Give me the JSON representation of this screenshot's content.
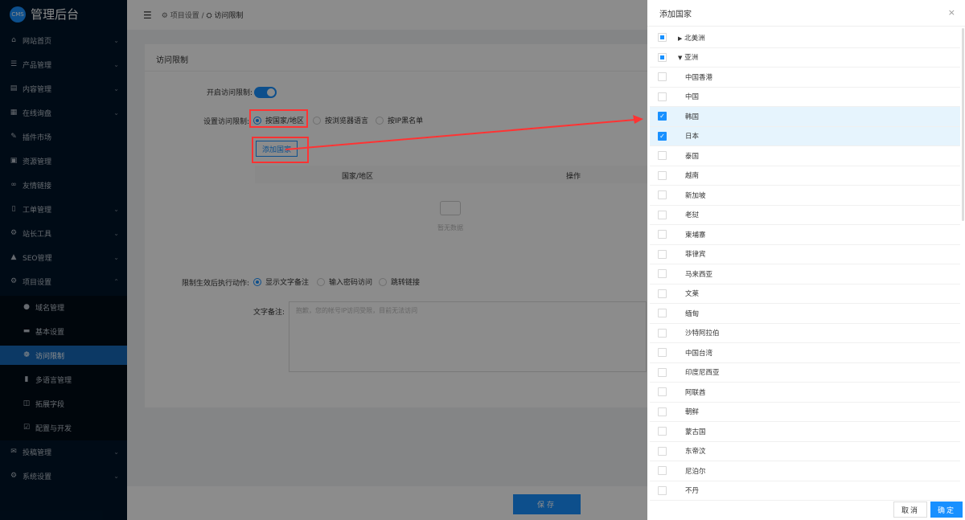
{
  "app": {
    "logo_badge": "CMS",
    "title": "管理后台"
  },
  "sidebar": {
    "items": [
      {
        "label": "网站首页",
        "icon": "home-icon",
        "chev": "⌄"
      },
      {
        "label": "产品管理",
        "icon": "list-icon",
        "chev": "⌄"
      },
      {
        "label": "内容管理",
        "icon": "content-icon",
        "chev": "⌄"
      },
      {
        "label": "在线询盘",
        "icon": "table-icon",
        "chev": "⌄"
      },
      {
        "label": "插件市场",
        "icon": "pin-icon",
        "chev": ""
      },
      {
        "label": "资源管理",
        "icon": "grid-icon",
        "chev": ""
      },
      {
        "label": "友情链接",
        "icon": "link-icon",
        "chev": ""
      },
      {
        "label": "工单管理",
        "icon": "file-icon",
        "chev": "⌄"
      },
      {
        "label": "站长工具",
        "icon": "tools-icon",
        "chev": "⌄"
      },
      {
        "label": "SEO管理",
        "icon": "warning-icon",
        "chev": "⌄"
      },
      {
        "label": "项目设置",
        "icon": "gear-icon",
        "chev": "⌃"
      }
    ],
    "sub_items": [
      {
        "label": "域名管理",
        "icon": "globe-icon"
      },
      {
        "label": "基本设置",
        "icon": "window-icon"
      },
      {
        "label": "访问限制",
        "icon": "shield-icon"
      },
      {
        "label": "多语言管理",
        "icon": "book-icon"
      },
      {
        "label": "拓展字段",
        "icon": "box-icon"
      },
      {
        "label": "配置与开发",
        "icon": "check-square-icon"
      }
    ],
    "bottom_items": [
      {
        "label": "投稿管理",
        "icon": "mail-icon",
        "chev": "⌄"
      },
      {
        "label": "系统设置",
        "icon": "gear-icon",
        "chev": "⌄"
      }
    ]
  },
  "breadcrumb": {
    "parent": "项目设置",
    "current": "访问限制"
  },
  "card": {
    "title": "访问限制",
    "enable_label": "开启访问限制:",
    "enable_on": true,
    "mode_label": "设置访问限制:",
    "modes": [
      "按国家/地区",
      "按浏览器语言",
      "按IP黑名单"
    ],
    "add_button": "添加国家",
    "table_headers": [
      "国家/地区",
      "操作"
    ],
    "empty_text": "暂无数据",
    "action_label": "限制生效后执行动作:",
    "actions": [
      "显示文字备注",
      "输入密码访问",
      "跳转链接"
    ],
    "note_label": "文字备注:",
    "note_placeholder": "抱歉，您的帐号IP访问受限，目前无法访问"
  },
  "save_button": "保存",
  "drawer": {
    "title": "添加国家",
    "close": "×",
    "rows": [
      {
        "label": "北美洲",
        "group": true,
        "expanded": false,
        "state": "indeterminate"
      },
      {
        "label": "亚洲",
        "group": true,
        "expanded": true,
        "state": "indeterminate"
      },
      {
        "label": "中国香港",
        "state": "unchecked"
      },
      {
        "label": "中国",
        "state": "unchecked"
      },
      {
        "label": "韩国",
        "state": "checked"
      },
      {
        "label": "日本",
        "state": "checked"
      },
      {
        "label": "泰国",
        "state": "unchecked"
      },
      {
        "label": "越南",
        "state": "unchecked"
      },
      {
        "label": "新加坡",
        "state": "unchecked"
      },
      {
        "label": "老挝",
        "state": "unchecked"
      },
      {
        "label": "柬埔寨",
        "state": "unchecked"
      },
      {
        "label": "菲律宾",
        "state": "unchecked"
      },
      {
        "label": "马来西亚",
        "state": "unchecked"
      },
      {
        "label": "文莱",
        "state": "unchecked"
      },
      {
        "label": "缅甸",
        "state": "unchecked"
      },
      {
        "label": "沙特阿拉伯",
        "state": "unchecked"
      },
      {
        "label": "中国台湾",
        "state": "unchecked"
      },
      {
        "label": "印度尼西亚",
        "state": "unchecked"
      },
      {
        "label": "阿联酋",
        "state": "unchecked"
      },
      {
        "label": "朝鲜",
        "state": "unchecked"
      },
      {
        "label": "蒙古国",
        "state": "unchecked"
      },
      {
        "label": "东帝汶",
        "state": "unchecked"
      },
      {
        "label": "尼泊尔",
        "state": "unchecked"
      },
      {
        "label": "不丹",
        "state": "unchecked"
      }
    ],
    "cancel": "取消",
    "confirm": "确定"
  },
  "colors": {
    "accent": "#1890ff",
    "sidebar": "#001529",
    "annotation": "#ff3333"
  }
}
